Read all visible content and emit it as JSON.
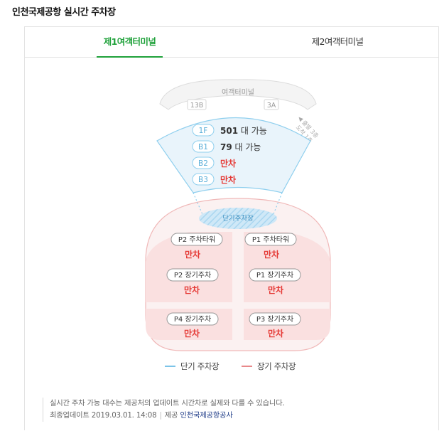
{
  "page_title": "인천국제공항 실시간 주차장",
  "tabs": [
    {
      "label": "제1여객터미널",
      "active": true
    },
    {
      "label": "제2여객터미널",
      "active": false
    }
  ],
  "terminal": {
    "label": "여객터미널",
    "gate_left": "13B",
    "gate_right": "3A",
    "arrival_note_1": "출발 3층",
    "arrival_note_2": "도착 1층"
  },
  "short_term": {
    "zone_label": "단기주차장",
    "floors": [
      {
        "floor": "1F",
        "count": "501",
        "unit": "대 가능",
        "full": false
      },
      {
        "floor": "B1",
        "count": "79",
        "unit": "대 가능",
        "full": false
      },
      {
        "floor": "B2",
        "status": "만차",
        "full": true
      },
      {
        "floor": "B3",
        "status": "만차",
        "full": true
      }
    ]
  },
  "long_term": {
    "lots": [
      {
        "name": "P2 주차타워",
        "status": "만차"
      },
      {
        "name": "P1 주차타워",
        "status": "만차"
      },
      {
        "name": "P2 장기주차",
        "status": "만차"
      },
      {
        "name": "P1 장기주차",
        "status": "만차"
      },
      {
        "name": "P4 장기주차",
        "status": "만차"
      },
      {
        "name": "P3 장기주차",
        "status": "만차"
      }
    ]
  },
  "legend": {
    "short_label": "단기 주차장",
    "long_label": "장기 주차장"
  },
  "notes": {
    "line1": "실시간 주차 가능 대수는 제공처의 업데이트 시간차로 실제와 다를 수 있습니다.",
    "updated_label": "최종업데이트 2019.03.01. 14:08",
    "provider_label": "제공",
    "provider_name": "인천국제공항공사"
  },
  "colors": {
    "accent_green": "#1fa13a",
    "short_blue": "#7cc4e8",
    "long_red": "#e8888a",
    "full_red": "#e53935"
  }
}
